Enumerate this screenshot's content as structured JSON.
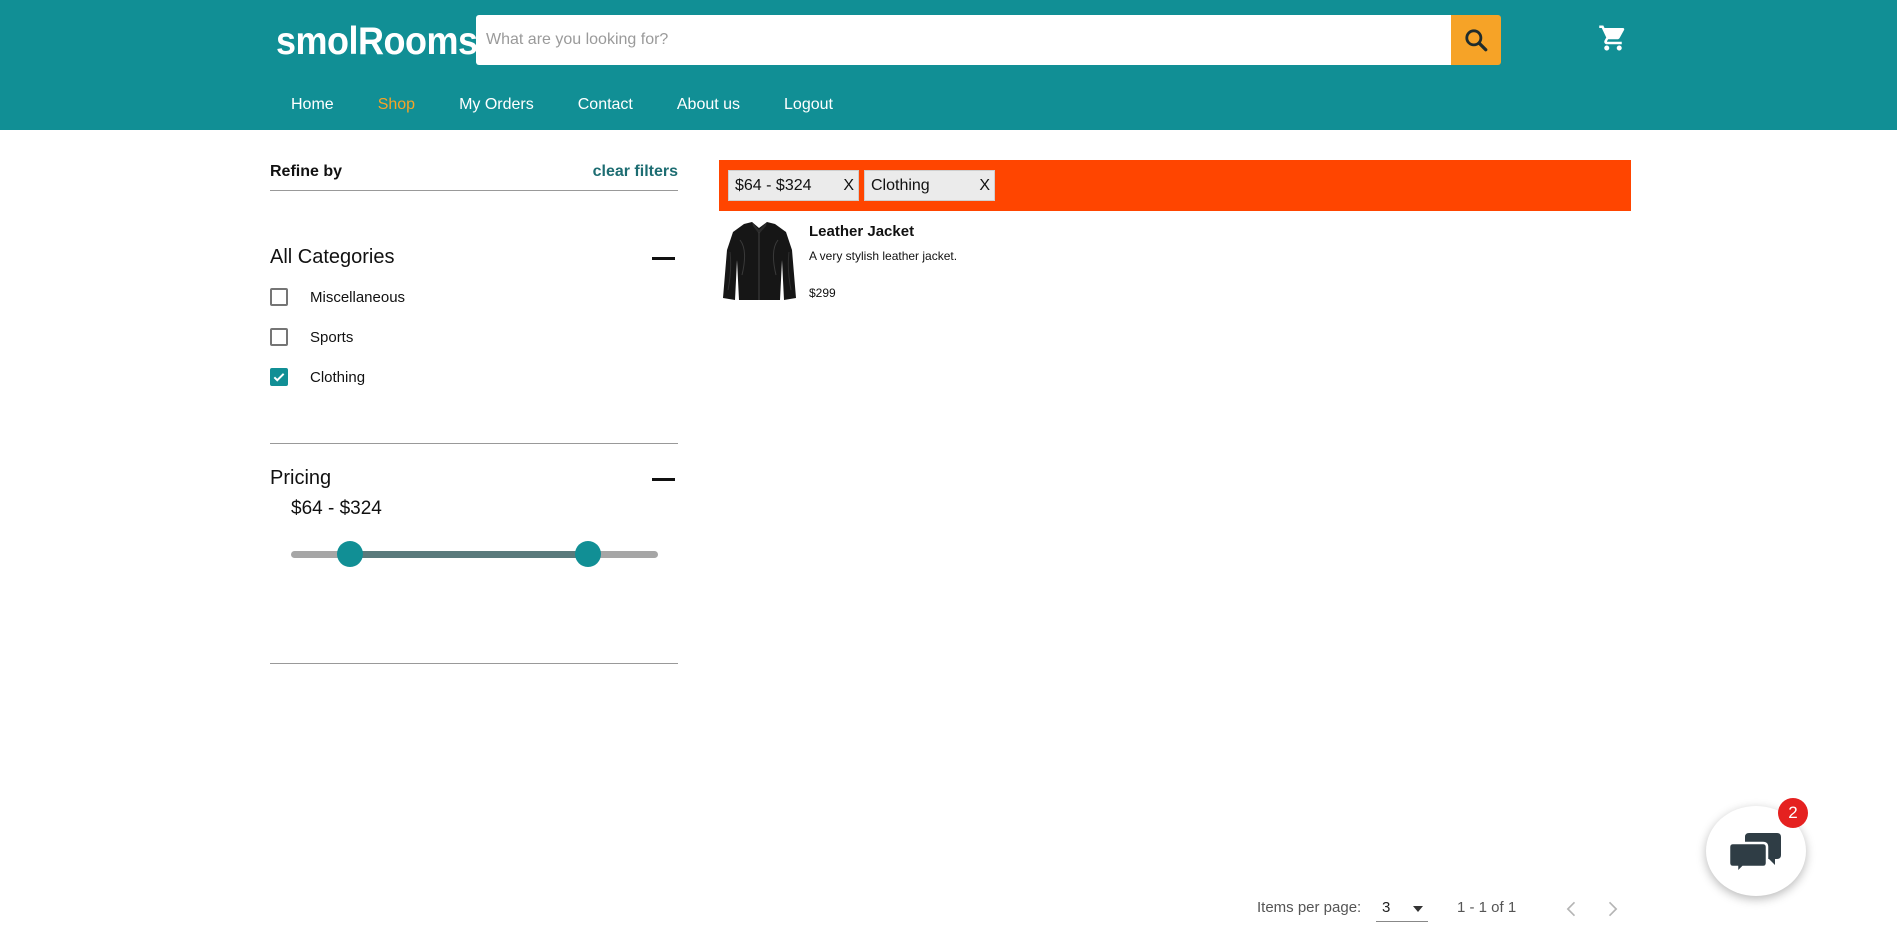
{
  "brand": {
    "name": "smolRooms"
  },
  "search": {
    "placeholder": "What are you looking for?",
    "value": "",
    "icon": "search-icon"
  },
  "cart": {
    "icon": "cart-icon"
  },
  "nav": {
    "items": [
      {
        "label": "Home",
        "active": false
      },
      {
        "label": "Shop",
        "active": true
      },
      {
        "label": "My Orders",
        "active": false
      },
      {
        "label": "Contact",
        "active": false
      },
      {
        "label": "About us",
        "active": false
      },
      {
        "label": "Logout",
        "active": false
      }
    ]
  },
  "sidebar": {
    "refine_label": "Refine by",
    "clear_filters_label": "clear filters",
    "categories": {
      "title": "All Categories",
      "items": [
        {
          "label": "Miscellaneous",
          "checked": false
        },
        {
          "label": "Sports",
          "checked": false
        },
        {
          "label": "Clothing",
          "checked": true
        }
      ]
    },
    "pricing": {
      "title": "Pricing",
      "range_text": "$64 - $324",
      "min_value": 64,
      "max_value": 324,
      "slider_low_fraction": 0.16,
      "slider_high_fraction": 0.81
    }
  },
  "active_filters": [
    {
      "label": "$64 - $324",
      "remove": "X"
    },
    {
      "label": "Clothing",
      "remove": "X"
    }
  ],
  "products": [
    {
      "name": "Leather Jacket",
      "description": "A very stylish leather jacket.",
      "price": "$299"
    }
  ],
  "paginator": {
    "items_per_page_label": "Items per page:",
    "items_per_page_value": "3",
    "range_label": "1 - 1 of 1"
  },
  "chat": {
    "badge_count": "2",
    "icon": "chat-bubbles-icon"
  },
  "colors": {
    "header": "#118f95",
    "accent": "#f6a327",
    "filter_bar": "#ff4500",
    "badge": "#e52120"
  }
}
